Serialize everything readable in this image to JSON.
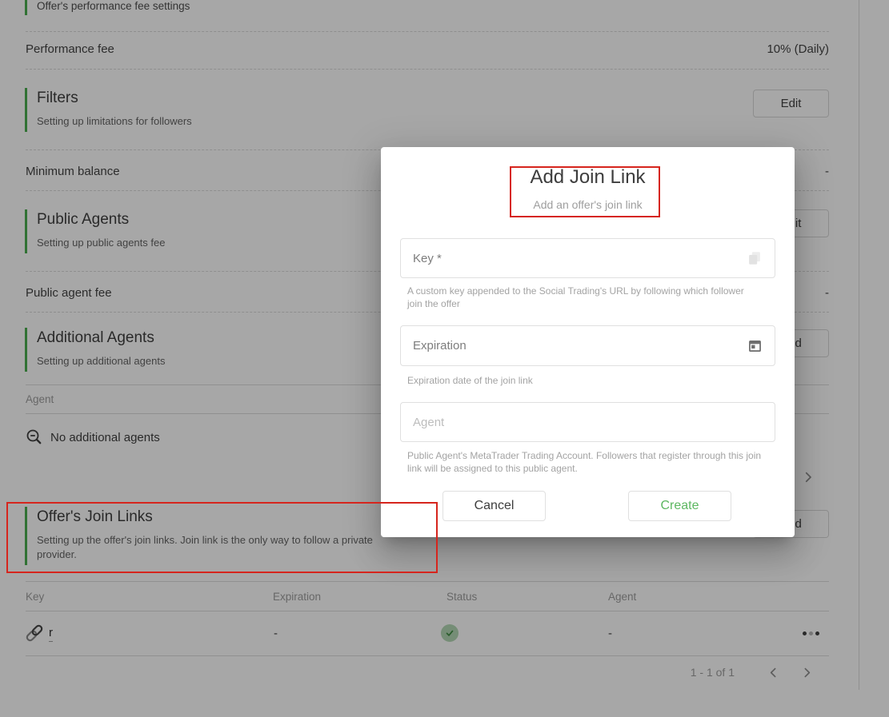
{
  "page": {
    "performance_settings": {
      "subtitle": "Offer's performance fee settings"
    },
    "performance_fee": {
      "label": "Performance fee",
      "value": "10% (Daily)"
    },
    "filters": {
      "title": "Filters",
      "subtitle": "Setting up limitations for followers",
      "edit_label": "Edit"
    },
    "minimum_balance": {
      "label": "Minimum balance",
      "value": "-"
    },
    "public_agents": {
      "title": "Public Agents",
      "subtitle": "Setting up public agents fee",
      "edit_label": "Edit"
    },
    "public_agent_fee": {
      "label": "Public agent fee",
      "value": "-"
    },
    "additional_agents": {
      "title": "Additional Agents",
      "subtitle": "Setting up additional agents",
      "add_label": "Add",
      "column_header": "Agent",
      "empty_text": "No additional agents",
      "empty_icon": "zoom-out-icon"
    },
    "join_links": {
      "title": "Offer's Join Links",
      "subtitle": "Setting up the offer's join links. Join link is the only way to follow a private provider.",
      "add_label": "Add",
      "columns": [
        "Key",
        "Expiration",
        "Status",
        "Agent"
      ],
      "row": {
        "key": "r",
        "expiration": "-",
        "status_icon": "check-circle",
        "agent": "-",
        "key_icon": "link-icon",
        "menu_icon": "ellipsis-icon"
      },
      "pagination": {
        "range": "1 - 1 of 1"
      }
    }
  },
  "modal": {
    "title": "Add Join Link",
    "subtitle": "Add an offer's join link",
    "key_field": {
      "label": "Key *",
      "value": "",
      "icon": "copy-icon",
      "helper": "A custom key appended to the Social Trading's URL by following which follower join the offer"
    },
    "expiration_field": {
      "label": "Expiration",
      "value": "",
      "icon": "calendar-icon",
      "helper": "Expiration date of the join link"
    },
    "agent_field": {
      "placeholder": "Agent",
      "value": "",
      "helper": "Public Agent's MetaTrader Trading Account. Followers that register through this join link will be assigned to this public agent."
    },
    "cancel_label": "Cancel",
    "create_label": "Create"
  },
  "colors": {
    "accent_green": "#4caf50",
    "annotation_red": "#d6251d",
    "create_green": "#5db761",
    "status_circle_bg": "#b3d8b4",
    "status_check": "#3f8c43",
    "backdrop": "rgba(0,0,0,0.345)"
  }
}
